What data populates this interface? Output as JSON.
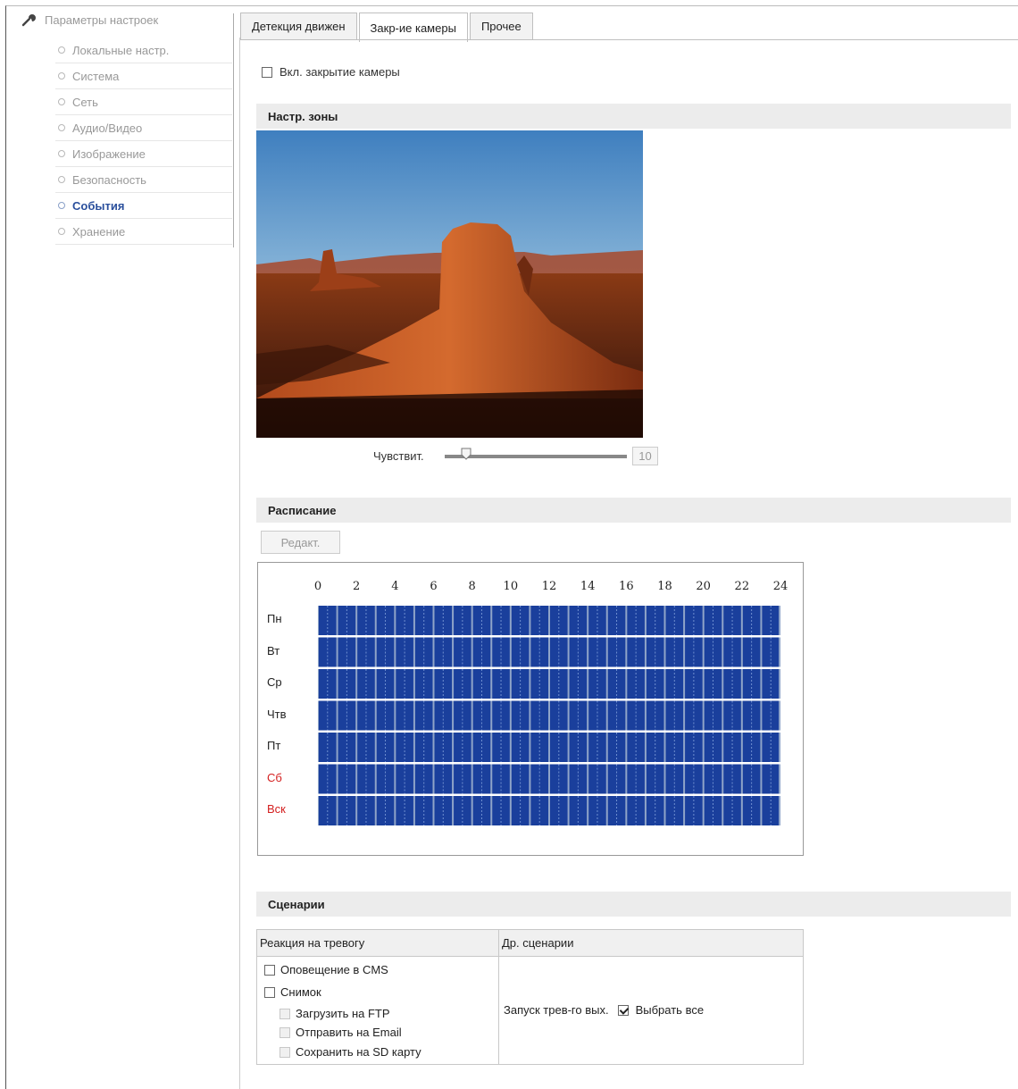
{
  "sidebar": {
    "title": "Параметры настроек",
    "items": [
      {
        "label": "Локальные настр.",
        "active": false
      },
      {
        "label": "Система",
        "active": false
      },
      {
        "label": "Сеть",
        "active": false
      },
      {
        "label": "Аудио/Видео",
        "active": false
      },
      {
        "label": "Изображение",
        "active": false
      },
      {
        "label": "Безопасность",
        "active": false
      },
      {
        "label": "События",
        "active": true
      },
      {
        "label": "Хранение",
        "active": false
      }
    ]
  },
  "tabs": [
    {
      "label": "Детекция движен",
      "active": false
    },
    {
      "label": "Закр-ие камеры",
      "active": true
    },
    {
      "label": "Прочее",
      "active": false
    }
  ],
  "enable": {
    "label": "Вкл. закрытие камеры",
    "checked": false
  },
  "zone": {
    "section_title": "Настр. зоны",
    "sensitivity_label": "Чувствит.",
    "sensitivity_value": "10",
    "sensitivity_level": 10
  },
  "schedule": {
    "section_title": "Расписание",
    "edit_label": "Редакт.",
    "hours": [
      "0",
      "2",
      "4",
      "6",
      "8",
      "10",
      "12",
      "14",
      "16",
      "18",
      "20",
      "22",
      "24"
    ],
    "days": [
      {
        "label": "Пн",
        "weekend": false
      },
      {
        "label": "Вт",
        "weekend": false
      },
      {
        "label": "Ср",
        "weekend": false
      },
      {
        "label": "Чтв",
        "weekend": false
      },
      {
        "label": "Пт",
        "weekend": false
      },
      {
        "label": "Сб",
        "weekend": true
      },
      {
        "label": "Вск",
        "weekend": true
      }
    ],
    "fill_color": "#1a3f9c"
  },
  "scenarios": {
    "section_title": "Сценарии",
    "col_alarm": "Реакция на тревогу",
    "col_other": "Др. сценарии",
    "alarm_options": [
      {
        "label": "Оповещение в CMS",
        "checked": false,
        "enabled": true
      },
      {
        "label": "Снимок",
        "checked": false,
        "enabled": true
      },
      {
        "label": "Загрузить на FTP",
        "checked": false,
        "enabled": false
      },
      {
        "label": "Отправить на Email",
        "checked": false,
        "enabled": false
      },
      {
        "label": "Сохранить на SD карту",
        "checked": false,
        "enabled": false
      }
    ],
    "trigger_output_label": "Запуск трев-го вых.",
    "select_all_label": "Выбрать все",
    "select_all_checked": true
  }
}
